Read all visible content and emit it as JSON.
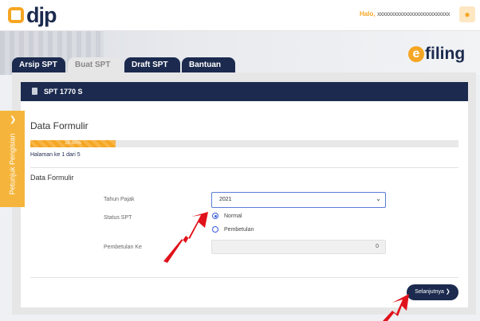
{
  "header": {
    "logo_text": "djp",
    "greeting": "Halo,",
    "user_name": "xxxxxxxxxxxxxxxxxxxxxxxxxx",
    "accent": "#f5a623",
    "brand": "#1b2a4e"
  },
  "tabs": [
    {
      "label": "Arsip SPT",
      "active": false
    },
    {
      "label": "Buat SPT",
      "active": true
    },
    {
      "label": "Draft SPT",
      "active": false
    },
    {
      "label": "Bantuan",
      "active": false
    }
  ],
  "brand_logo": {
    "e": "e",
    "text": "filing"
  },
  "form_header": {
    "title": "SPT 1770 S"
  },
  "side_tab": {
    "label": "Petunjuk Pengisian"
  },
  "main": {
    "section_title": "Data Formulir",
    "progress": {
      "percent": 20,
      "label": "20.00%"
    },
    "page_info": "Halaman ke 1 dari 5",
    "sub_title": "Data Formulir",
    "fields": {
      "tahun_pajak_label": "Tahun Pajak",
      "tahun_pajak_value": "2021",
      "status_label": "Status SPT",
      "status_options": [
        {
          "label": "Normal",
          "selected": true
        },
        {
          "label": "Pembetulan",
          "selected": false
        }
      ],
      "pembetulan_label": "Pembetulan Ke",
      "pembetulan_value": "0"
    },
    "next_button": "Selanjutnya"
  }
}
